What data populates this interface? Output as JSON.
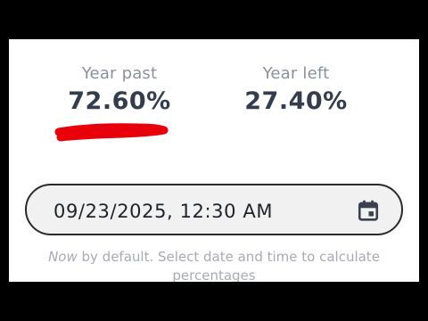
{
  "stats": {
    "past": {
      "label": "Year past",
      "value": "72.60%"
    },
    "left": {
      "label": "Year left",
      "value": "27.40%"
    }
  },
  "date_input": {
    "value": "09/23/2025, 12:30 AM",
    "icon": "calendar-icon"
  },
  "helper": {
    "emphasis": "Now",
    "text": " by default. Select date and time to calculate percentages"
  },
  "colors": {
    "value_text": "#333d4d",
    "label_text": "#8b919b",
    "annotation": "#e8000b"
  }
}
